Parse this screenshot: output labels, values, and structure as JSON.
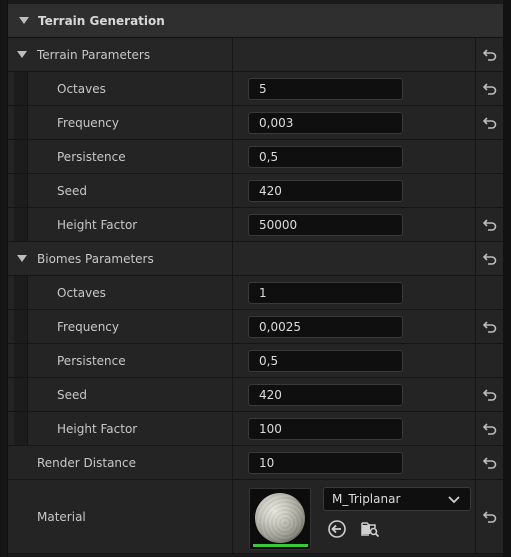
{
  "section": {
    "title": "Terrain Generation"
  },
  "terrain": {
    "title": "Terrain Parameters",
    "rows": [
      {
        "label": "Octaves",
        "value": "5"
      },
      {
        "label": "Frequency",
        "value": "0,003"
      },
      {
        "label": "Persistence",
        "value": "0,5"
      },
      {
        "label": "Seed",
        "value": "420"
      },
      {
        "label": "Height Factor",
        "value": "50000"
      }
    ]
  },
  "biomes": {
    "title": "Biomes Parameters",
    "rows": [
      {
        "label": "Octaves",
        "value": "1"
      },
      {
        "label": "Frequency",
        "value": "0,0025"
      },
      {
        "label": "Persistence",
        "value": "0,5"
      },
      {
        "label": "Seed",
        "value": "420"
      },
      {
        "label": "Height Factor",
        "value": "100"
      }
    ]
  },
  "render_distance": {
    "label": "Render Distance",
    "value": "10"
  },
  "material": {
    "label": "Material",
    "selected": "M_Triplanar"
  },
  "icons": {
    "expand": "chevron-down-icon",
    "reset": "reset-to-default-icon",
    "use_selected": "use-selected-arrow-icon",
    "browse": "browse-folder-icon"
  },
  "colors": {
    "thumb_bar": "#3cc43c"
  }
}
